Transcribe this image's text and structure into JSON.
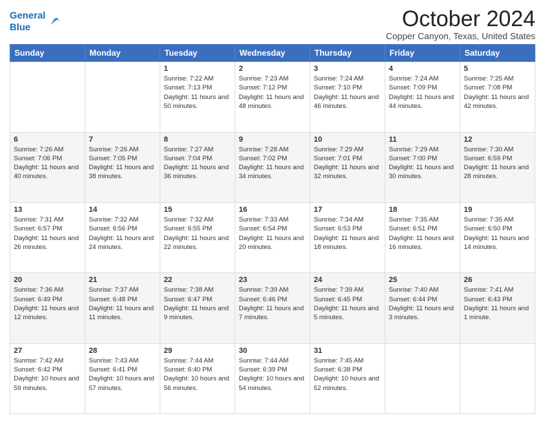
{
  "header": {
    "logo_line1": "General",
    "logo_line2": "Blue",
    "month": "October 2024",
    "location": "Copper Canyon, Texas, United States"
  },
  "days_of_week": [
    "Sunday",
    "Monday",
    "Tuesday",
    "Wednesday",
    "Thursday",
    "Friday",
    "Saturday"
  ],
  "weeks": [
    [
      {
        "day": "",
        "info": ""
      },
      {
        "day": "",
        "info": ""
      },
      {
        "day": "1",
        "info": "Sunrise: 7:22 AM\nSunset: 7:13 PM\nDaylight: 11 hours and 50 minutes."
      },
      {
        "day": "2",
        "info": "Sunrise: 7:23 AM\nSunset: 7:12 PM\nDaylight: 11 hours and 48 minutes."
      },
      {
        "day": "3",
        "info": "Sunrise: 7:24 AM\nSunset: 7:10 PM\nDaylight: 11 hours and 46 minutes."
      },
      {
        "day": "4",
        "info": "Sunrise: 7:24 AM\nSunset: 7:09 PM\nDaylight: 11 hours and 44 minutes."
      },
      {
        "day": "5",
        "info": "Sunrise: 7:25 AM\nSunset: 7:08 PM\nDaylight: 11 hours and 42 minutes."
      }
    ],
    [
      {
        "day": "6",
        "info": "Sunrise: 7:26 AM\nSunset: 7:06 PM\nDaylight: 11 hours and 40 minutes."
      },
      {
        "day": "7",
        "info": "Sunrise: 7:26 AM\nSunset: 7:05 PM\nDaylight: 11 hours and 38 minutes."
      },
      {
        "day": "8",
        "info": "Sunrise: 7:27 AM\nSunset: 7:04 PM\nDaylight: 11 hours and 36 minutes."
      },
      {
        "day": "9",
        "info": "Sunrise: 7:28 AM\nSunset: 7:02 PM\nDaylight: 11 hours and 34 minutes."
      },
      {
        "day": "10",
        "info": "Sunrise: 7:29 AM\nSunset: 7:01 PM\nDaylight: 11 hours and 32 minutes."
      },
      {
        "day": "11",
        "info": "Sunrise: 7:29 AM\nSunset: 7:00 PM\nDaylight: 11 hours and 30 minutes."
      },
      {
        "day": "12",
        "info": "Sunrise: 7:30 AM\nSunset: 6:59 PM\nDaylight: 11 hours and 28 minutes."
      }
    ],
    [
      {
        "day": "13",
        "info": "Sunrise: 7:31 AM\nSunset: 6:57 PM\nDaylight: 11 hours and 26 minutes."
      },
      {
        "day": "14",
        "info": "Sunrise: 7:32 AM\nSunset: 6:56 PM\nDaylight: 11 hours and 24 minutes."
      },
      {
        "day": "15",
        "info": "Sunrise: 7:32 AM\nSunset: 6:55 PM\nDaylight: 11 hours and 22 minutes."
      },
      {
        "day": "16",
        "info": "Sunrise: 7:33 AM\nSunset: 6:54 PM\nDaylight: 11 hours and 20 minutes."
      },
      {
        "day": "17",
        "info": "Sunrise: 7:34 AM\nSunset: 6:53 PM\nDaylight: 11 hours and 18 minutes."
      },
      {
        "day": "18",
        "info": "Sunrise: 7:35 AM\nSunset: 6:51 PM\nDaylight: 11 hours and 16 minutes."
      },
      {
        "day": "19",
        "info": "Sunrise: 7:35 AM\nSunset: 6:50 PM\nDaylight: 11 hours and 14 minutes."
      }
    ],
    [
      {
        "day": "20",
        "info": "Sunrise: 7:36 AM\nSunset: 6:49 PM\nDaylight: 11 hours and 12 minutes."
      },
      {
        "day": "21",
        "info": "Sunrise: 7:37 AM\nSunset: 6:48 PM\nDaylight: 11 hours and 11 minutes."
      },
      {
        "day": "22",
        "info": "Sunrise: 7:38 AM\nSunset: 6:47 PM\nDaylight: 11 hours and 9 minutes."
      },
      {
        "day": "23",
        "info": "Sunrise: 7:39 AM\nSunset: 6:46 PM\nDaylight: 11 hours and 7 minutes."
      },
      {
        "day": "24",
        "info": "Sunrise: 7:39 AM\nSunset: 6:45 PM\nDaylight: 11 hours and 5 minutes."
      },
      {
        "day": "25",
        "info": "Sunrise: 7:40 AM\nSunset: 6:44 PM\nDaylight: 11 hours and 3 minutes."
      },
      {
        "day": "26",
        "info": "Sunrise: 7:41 AM\nSunset: 6:43 PM\nDaylight: 11 hours and 1 minute."
      }
    ],
    [
      {
        "day": "27",
        "info": "Sunrise: 7:42 AM\nSunset: 6:42 PM\nDaylight: 10 hours and 59 minutes."
      },
      {
        "day": "28",
        "info": "Sunrise: 7:43 AM\nSunset: 6:41 PM\nDaylight: 10 hours and 57 minutes."
      },
      {
        "day": "29",
        "info": "Sunrise: 7:44 AM\nSunset: 6:40 PM\nDaylight: 10 hours and 56 minutes."
      },
      {
        "day": "30",
        "info": "Sunrise: 7:44 AM\nSunset: 6:39 PM\nDaylight: 10 hours and 54 minutes."
      },
      {
        "day": "31",
        "info": "Sunrise: 7:45 AM\nSunset: 6:38 PM\nDaylight: 10 hours and 52 minutes."
      },
      {
        "day": "",
        "info": ""
      },
      {
        "day": "",
        "info": ""
      }
    ]
  ]
}
